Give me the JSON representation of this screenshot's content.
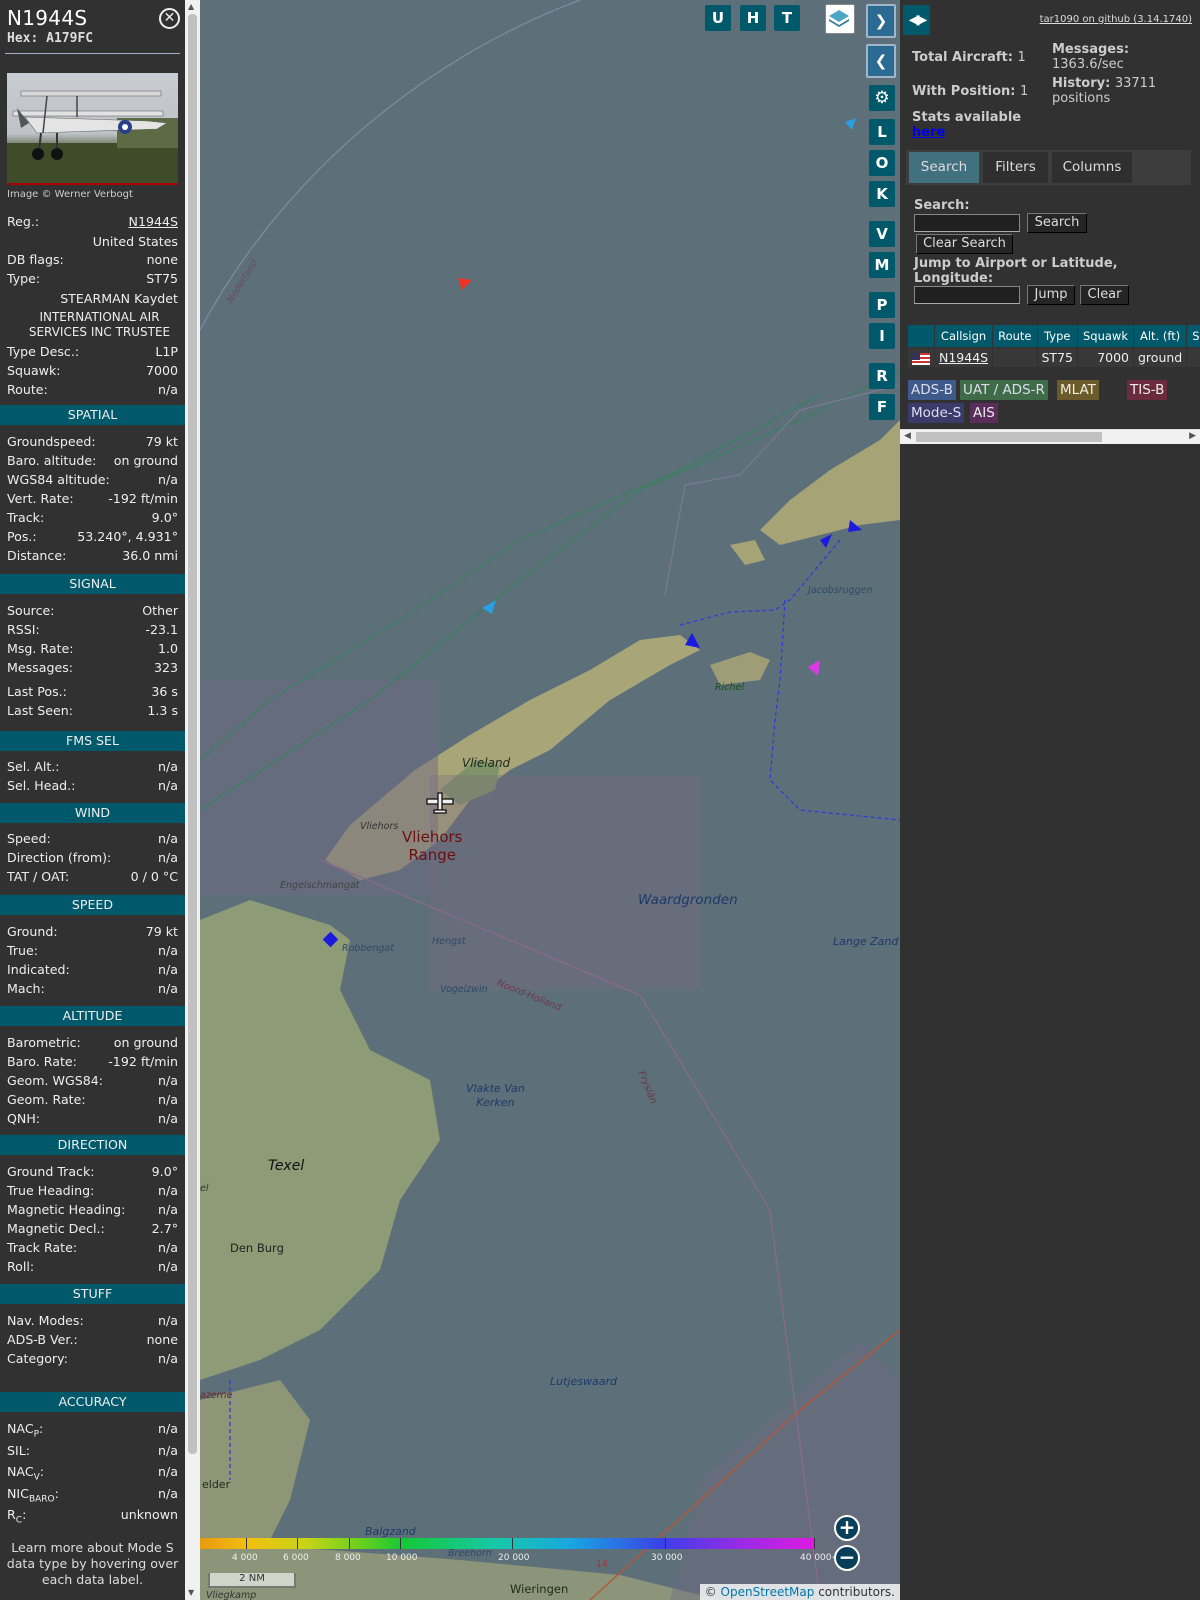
{
  "aircraft": {
    "callsign": "N1944S",
    "hex": "Hex: A179FC",
    "image_credit": "Image © Werner Verbogt"
  },
  "details": {
    "reg_label": "Reg.:",
    "reg": "N1944S",
    "country": "United States",
    "dbflags_label": "DB flags:",
    "dbflags": "none",
    "type_label": "Type:",
    "type": "ST75",
    "model": "STEARMAN Kaydet",
    "owner": "INTERNATIONAL AIR SERVICES INC TRUSTEE",
    "typedesc_label": "Type Desc.:",
    "typedesc": "L1P",
    "squawk_label": "Squawk:",
    "squawk": "7000",
    "route_label": "Route:",
    "route": "n/a"
  },
  "sections": {
    "spatial": "SPATIAL",
    "signal": "SIGNAL",
    "fms": "FMS SEL",
    "wind": "WIND",
    "speed": "SPEED",
    "altitude": "ALTITUDE",
    "direction": "DIRECTION",
    "stuff": "STUFF",
    "accuracy": "ACCURACY"
  },
  "spatial": [
    {
      "k": "Groundspeed:",
      "v": "79 kt"
    },
    {
      "k": "Baro. altitude:",
      "v": "on ground"
    },
    {
      "k": "WGS84 altitude:",
      "v": "n/a"
    },
    {
      "k": "Vert. Rate:",
      "v": "-192 ft/min"
    },
    {
      "k": "Track:",
      "v": "9.0°"
    },
    {
      "k": "Pos.:",
      "v": "53.240°, 4.931°"
    },
    {
      "k": "Distance:",
      "v": "36.0 nmi"
    }
  ],
  "signal": [
    {
      "k": "Source:",
      "v": "Other"
    },
    {
      "k": "RSSI:",
      "v": "-23.1"
    },
    {
      "k": "Msg. Rate:",
      "v": "1.0"
    },
    {
      "k": "Messages:",
      "v": "323"
    },
    {
      "k": "Last Pos.:",
      "v": "36 s"
    },
    {
      "k": "Last Seen:",
      "v": "1.3 s"
    }
  ],
  "fms": [
    {
      "k": "Sel. Alt.:",
      "v": "n/a"
    },
    {
      "k": "Sel. Head.:",
      "v": "n/a"
    }
  ],
  "wind": [
    {
      "k": "Speed:",
      "v": "n/a"
    },
    {
      "k": "Direction (from):",
      "v": "n/a"
    },
    {
      "k": "TAT / OAT:",
      "v": "0 / 0 °C"
    }
  ],
  "speed": [
    {
      "k": "Ground:",
      "v": "79 kt"
    },
    {
      "k": "True:",
      "v": "n/a"
    },
    {
      "k": "Indicated:",
      "v": "n/a"
    },
    {
      "k": "Mach:",
      "v": "n/a"
    }
  ],
  "altitude": [
    {
      "k": "Barometric:",
      "v": "on ground"
    },
    {
      "k": "Baro. Rate:",
      "v": "-192 ft/min"
    },
    {
      "k": "Geom. WGS84:",
      "v": "n/a"
    },
    {
      "k": "Geom. Rate:",
      "v": "n/a"
    },
    {
      "k": "QNH:",
      "v": "n/a"
    }
  ],
  "direction": [
    {
      "k": "Ground Track:",
      "v": "9.0°"
    },
    {
      "k": "True Heading:",
      "v": "n/a"
    },
    {
      "k": "Magnetic Heading:",
      "v": "n/a"
    },
    {
      "k": "Magnetic Decl.:",
      "v": "2.7°"
    },
    {
      "k": "Track Rate:",
      "v": "n/a"
    },
    {
      "k": "Roll:",
      "v": "n/a"
    }
  ],
  "stuff": [
    {
      "k": "Nav. Modes:",
      "v": "n/a"
    },
    {
      "k": "ADS-B Ver.:",
      "v": "none"
    },
    {
      "k": "Category:",
      "v": "n/a"
    }
  ],
  "accuracy": [
    {
      "k": "NACP:",
      "k_main": "NAC",
      "k_sub": "P",
      "v": "n/a"
    },
    {
      "k": "SIL:",
      "v": "n/a"
    },
    {
      "k": "NACV:",
      "k_main": "NAC",
      "k_sub": "V",
      "v": "n/a"
    },
    {
      "k": "NICBARO:",
      "k_main": "NIC",
      "k_sub": "BARO",
      "v": "n/a"
    },
    {
      "k": "RC:",
      "k_main": "R",
      "k_sub": "C",
      "v": "unknown"
    }
  ],
  "learn_more": "Learn more about Mode S data type by hovering over each data label.",
  "map": {
    "buttons_top": [
      "U",
      "H",
      "T"
    ],
    "buttons_side": [
      "L",
      "O",
      "K",
      "V",
      "M",
      "P",
      "I",
      "R",
      "F"
    ],
    "labels": {
      "vlieland": "Vlieland",
      "vliehors_range": "Vliehors\nRange",
      "vliehors": "Vliehors",
      "waardgronden": "Waardgronden",
      "texel": "Texel",
      "den_burg": "Den Burg",
      "lutjeswaard": "Lutjeswaard",
      "richel": "Richel",
      "jacobsruggen": "Jacobsruggen",
      "lange_zand": "Lange Zand",
      "engelschmangat": "Engelschmangat",
      "robbengat": "Robbengat",
      "hengst": "Hengst",
      "vogelzwin": "Vogelzwin",
      "noord_holland": "Noord-Holland",
      "vlakte": "Vlakte Van\nKerken",
      "friesland": "Fryslân",
      "nederland": "Nederland",
      "balgzand": "Balgzand",
      "wieringen": "Wieringen",
      "breehorn": "Breehorn",
      "vliegkamp": "Vliegkamp",
      "helder": "elder",
      "azerne": "azerne",
      "el": "el",
      "r14": "14"
    },
    "altitude_ticks": [
      "4 000",
      "6 000",
      "8 000",
      "10 000",
      "20 000",
      "30 000",
      "40 000+"
    ],
    "scale": "2 NM",
    "attribution_prefix": "© ",
    "attribution_link": "OpenStreetMap",
    "attribution_suffix": " contributors."
  },
  "right": {
    "github": "tar1090 on github (3.14.1740)",
    "total_label": "Total Aircraft:",
    "total": "1",
    "withpos_label": "With Position:",
    "withpos": "1",
    "stats_text": "Stats available",
    "stats_link": "here",
    "messages_label": "Messages:",
    "messages": "1363.6/sec",
    "history_label": "History:",
    "history": "33711",
    "history_unit": "positions",
    "tabs": [
      "Search",
      "Filters",
      "Columns"
    ],
    "search_label": "Search:",
    "search_button": "Search",
    "clear_search_button": "Clear Search",
    "jump_label": "Jump to Airport or Latitude, Longitude:",
    "jump_button": "Jump",
    "clear_button": "Clear",
    "table_headers": [
      "",
      "Callsign",
      "Route",
      "Type",
      "Squawk",
      "Alt. (ft)",
      "Spd."
    ],
    "table_rows": [
      {
        "flag": "us-flag-icon",
        "callsign": "N1944S",
        "route": "",
        "type": "ST75",
        "squawk": "7000",
        "alt": "ground",
        "spd": ""
      }
    ],
    "legend": [
      {
        "label": "ADS-B",
        "color": "#3d5a8a",
        "text": "#dde"
      },
      {
        "label": "UAT / ADS-R",
        "color": "#3f6b48",
        "text": "#dde"
      },
      {
        "label": "MLAT",
        "color": "#6b5a2a",
        "text": "#eed"
      },
      {
        "label": "TIS-B",
        "color": "#6b2a3d",
        "text": "#eee"
      },
      {
        "label": "Mode-S",
        "color": "#3a3a6b",
        "text": "#dde"
      },
      {
        "label": "AIS",
        "color": "#5a2d5a",
        "text": "#eee"
      }
    ]
  },
  "colors": {
    "accent": "#00596b",
    "panel": "#313131",
    "map_water": "#5d6f78"
  }
}
